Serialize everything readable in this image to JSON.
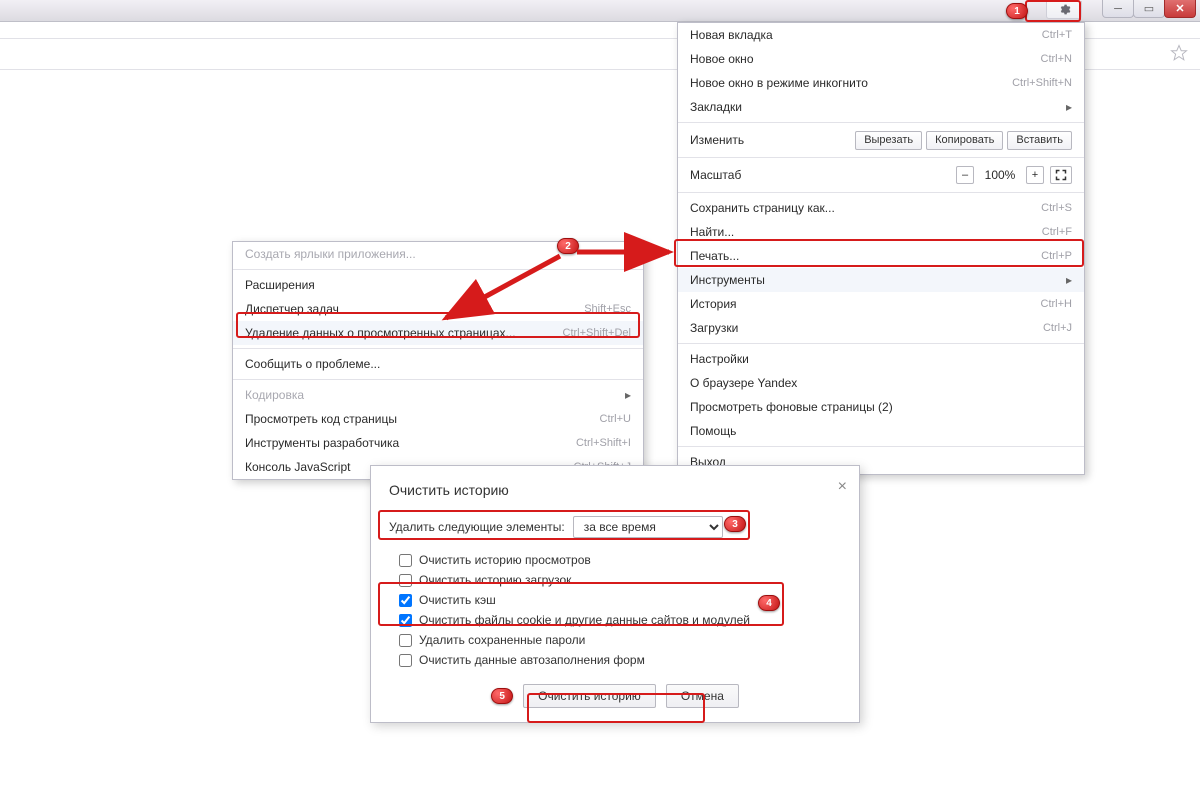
{
  "main_menu": {
    "items": [
      {
        "label": "Новая вкладка",
        "shortcut": "Ctrl+T"
      },
      {
        "label": "Новое окно",
        "shortcut": "Ctrl+N"
      },
      {
        "label": "Новое окно в режиме инкогнито",
        "shortcut": "Ctrl+Shift+N"
      },
      {
        "label": "Закладки",
        "submenu": true
      }
    ],
    "edit_label": "Изменить",
    "edit_cut": "Вырезать",
    "edit_copy": "Копировать",
    "edit_paste": "Вставить",
    "zoom_label": "Масштаб",
    "zoom_value": "100%",
    "items2": [
      {
        "label": "Сохранить страницу как...",
        "shortcut": "Ctrl+S"
      },
      {
        "label": "Найти...",
        "shortcut": "Ctrl+F"
      },
      {
        "label": "Печать...",
        "shortcut": "Ctrl+P"
      },
      {
        "label": "Инструменты",
        "submenu": true,
        "highlight": true
      },
      {
        "label": "История",
        "shortcut": "Ctrl+H"
      },
      {
        "label": "Загрузки",
        "shortcut": "Ctrl+J"
      }
    ],
    "items3": [
      {
        "label": "Настройки"
      },
      {
        "label": "О браузере Yandex"
      },
      {
        "label": "Просмотреть фоновые страницы (2)"
      },
      {
        "label": "Помощь"
      }
    ],
    "items4": [
      {
        "label": "Выход"
      }
    ]
  },
  "sub_menu": {
    "items": [
      {
        "label": "Создать ярлыки приложения...",
        "disabled": true
      },
      {
        "sep": true
      },
      {
        "label": "Расширения"
      },
      {
        "label": "Диспетчер задач",
        "shortcut": "Shift+Esc"
      },
      {
        "label": "Удаление данных о просмотренных страницах...",
        "shortcut": "Ctrl+Shift+Del",
        "highlight": true
      },
      {
        "sep": true
      },
      {
        "label": "Сообщить о проблеме..."
      },
      {
        "sep": true
      },
      {
        "label": "Кодировка",
        "submenu": true,
        "disabled": true
      },
      {
        "label": "Просмотреть код страницы",
        "shortcut": "Ctrl+U"
      },
      {
        "label": "Инструменты разработчика",
        "shortcut": "Ctrl+Shift+I"
      },
      {
        "label": "Консоль JavaScript",
        "shortcut": "Ctrl+Shift+J"
      }
    ]
  },
  "dialog": {
    "title": "Очистить историю",
    "select_label": "Удалить следующие элементы:",
    "select_value": "за все время",
    "checks": [
      {
        "label": "Очистить историю просмотров",
        "checked": false
      },
      {
        "label": "Очистить историю загрузок",
        "checked": false
      },
      {
        "label": "Очистить кэш",
        "checked": true
      },
      {
        "label": "Очистить файлы cookie и другие данные сайтов и модулей",
        "checked": true
      },
      {
        "label": "Удалить сохраненные пароли",
        "checked": false
      },
      {
        "label": "Очистить данные автозаполнения форм",
        "checked": false
      }
    ],
    "ok": "Очистить историю",
    "cancel": "Отмена"
  },
  "badges": {
    "b1": "1",
    "b2": "2",
    "b3": "3",
    "b4": "4",
    "b5": "5"
  }
}
